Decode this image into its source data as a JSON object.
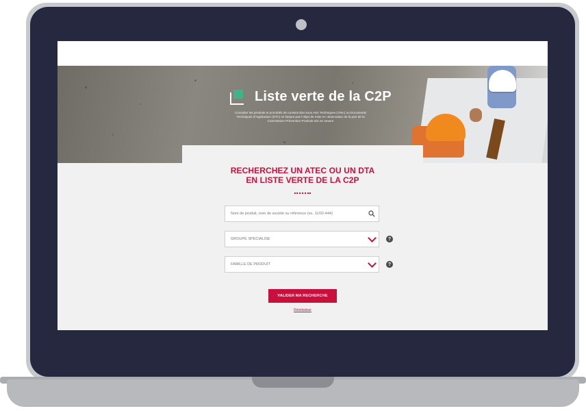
{
  "hero": {
    "title": "Liste verte de la C2P",
    "description": "Consulter les produits et procédés de construction sous Avis Techniques (ATec) ou Documents Techniques d’Application (DTA) ne faisant pas l’objet de mise en observation de la part de la Commission Prévention Produits mis en oeuvre"
  },
  "search": {
    "heading_line1": "RECHERCHEZ UN ATEC OU UN DTA",
    "heading_line2": "EN LISTE VERTE DE LA C2P",
    "query_placeholder": "Nom de produit, nom de société ou référence (ex. 11/02-444)",
    "group_placeholder": "GROUPE SPÉCIALISÉ",
    "family_placeholder": "FAMILLE DE PRODUIT",
    "help_symbol": "?",
    "submit_label": "VALIDER MA RECHERCHE",
    "reset_label": "Réinitialiser"
  },
  "colors": {
    "accent": "#c8103c",
    "logo_green": "#3fb38a",
    "bezel": "#262840"
  },
  "icons": {
    "search": "search-icon",
    "dropdown": "chevron-down-icon",
    "help": "help-icon",
    "logo": "c2p-logo-icon",
    "camera": "camera-icon"
  }
}
